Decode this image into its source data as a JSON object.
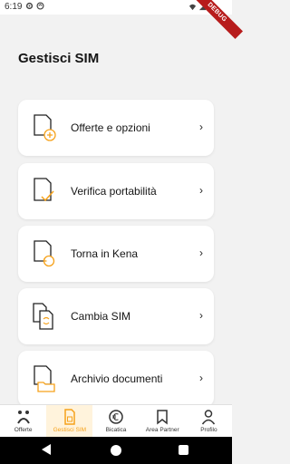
{
  "status": {
    "time": "6:19",
    "ribbon": "DEBUG"
  },
  "page": {
    "title": "Gestisci SIM"
  },
  "menu": {
    "items": [
      {
        "label": "Offerte e opzioni",
        "icon": "sim-plus-icon"
      },
      {
        "label": "Verifica portabilità",
        "icon": "sim-check-icon"
      },
      {
        "label": "Torna in Kena",
        "icon": "sim-return-icon"
      },
      {
        "label": "Cambia SIM",
        "icon": "sim-swap-icon"
      },
      {
        "label": "Archivio documenti",
        "icon": "folder-icon"
      }
    ],
    "chevron": "›"
  },
  "bottom_nav": {
    "items": [
      {
        "label": "Offerte",
        "active": false
      },
      {
        "label": "Gestisci SIM",
        "active": true
      },
      {
        "label": "Bicatica",
        "active": false
      },
      {
        "label": "Area Partner",
        "active": false
      },
      {
        "label": "Profilo",
        "active": false
      }
    ]
  },
  "colors": {
    "accent": "#f6a21b",
    "background": "#f2f2f2",
    "card": "#ffffff",
    "text": "#151515"
  }
}
